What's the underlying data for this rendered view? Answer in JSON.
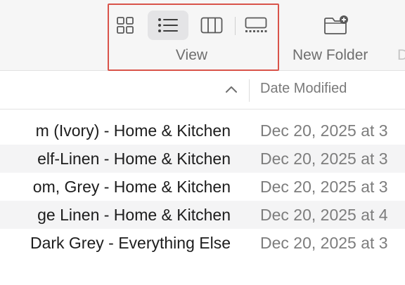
{
  "toolbar": {
    "view_group": {
      "label": "View",
      "buttons": [
        {
          "icon": "icon-view-grid-icon",
          "active": false
        },
        {
          "icon": "list-view-icon",
          "active": true
        },
        {
          "icon": "column-view-icon",
          "active": false
        },
        {
          "icon": "gallery-view-icon",
          "active": false
        }
      ],
      "highlight_color": "#d9534a"
    },
    "new_folder": {
      "label": "New Folder",
      "icon": "folder-plus-icon"
    },
    "clipped_label": "D"
  },
  "columns": {
    "date_modified": "Date Modified",
    "sort_indicator": "chevron-up-icon"
  },
  "rows": [
    {
      "name": "m (Ivory) - Home & Kitchen",
      "date": "Dec 20, 2025 at 3"
    },
    {
      "name": "elf-Linen - Home & Kitchen",
      "date": "Dec 20, 2025 at 3"
    },
    {
      "name": "om, Grey - Home & Kitchen",
      "date": "Dec 20, 2025 at 3"
    },
    {
      "name": "ge Linen - Home & Kitchen",
      "date": "Dec 20, 2025 at 4"
    },
    {
      "name": "Dark Grey - Everything Else",
      "date": "Dec 20, 2025 at 3"
    }
  ]
}
